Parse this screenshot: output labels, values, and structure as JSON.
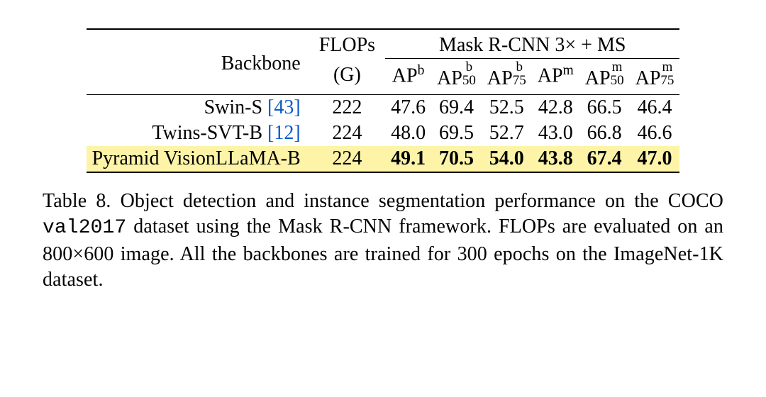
{
  "chart_data": {
    "type": "table",
    "title": "Table 8. Object detection and instance segmentation performance on the COCO val2017 dataset using the Mask R-CNN framework. FLOPs are evaluated on an 800×600 image. All the backbones are trained for 300 epochs on the ImageNet-1K dataset.",
    "columns": [
      "Backbone",
      "FLOPs (G)",
      "AP^b",
      "AP^b_50",
      "AP^b_75",
      "AP^m",
      "AP^m_50",
      "AP^m_75"
    ],
    "group_header": "Mask R-CNN 3× + MS",
    "rows": [
      {
        "backbone": "Swin-S",
        "cite": "[43]",
        "flops": "222",
        "apb": "47.6",
        "apb50": "69.4",
        "apb75": "52.5",
        "apm": "42.8",
        "apm50": "66.5",
        "apm75": "46.4",
        "highlight": false,
        "bold": false
      },
      {
        "backbone": "Twins-SVT-B",
        "cite": "[12]",
        "flops": "224",
        "apb": "48.0",
        "apb50": "69.5",
        "apb75": "52.7",
        "apm": "43.0",
        "apm50": "66.8",
        "apm75": "46.6",
        "highlight": false,
        "bold": false
      },
      {
        "backbone": "Pyramid VisionLLaMA-B",
        "cite": "",
        "flops": "224",
        "apb": "49.1",
        "apb50": "70.5",
        "apb75": "54.0",
        "apm": "43.8",
        "apm50": "67.4",
        "apm75": "47.0",
        "highlight": true,
        "bold": true
      }
    ]
  },
  "headers": {
    "backbone": "Backbone",
    "flops1": "FLOPs",
    "flops2": "(G)",
    "group": "Mask R-CNN 3× + MS",
    "apb": "AP",
    "apb_sup": "b",
    "apb50_sup": "b",
    "apb50_sub": "50",
    "apb75_sup": "b",
    "apb75_sub": "75",
    "apm_sup": "m",
    "apm50_sup": "m",
    "apm50_sub": "50",
    "apm75_sup": "m",
    "apm75_sub": "75"
  },
  "caption": {
    "prefix": "Table 8. Object detection and instance segmentation performance on the COCO ",
    "code": "val2017",
    "mid": " dataset using the Mask R-CNN framework. FLOPs are evaluated on an 800×600 image. All the backbones are trained for 300 epochs on the ImageNet-1K dataset."
  }
}
